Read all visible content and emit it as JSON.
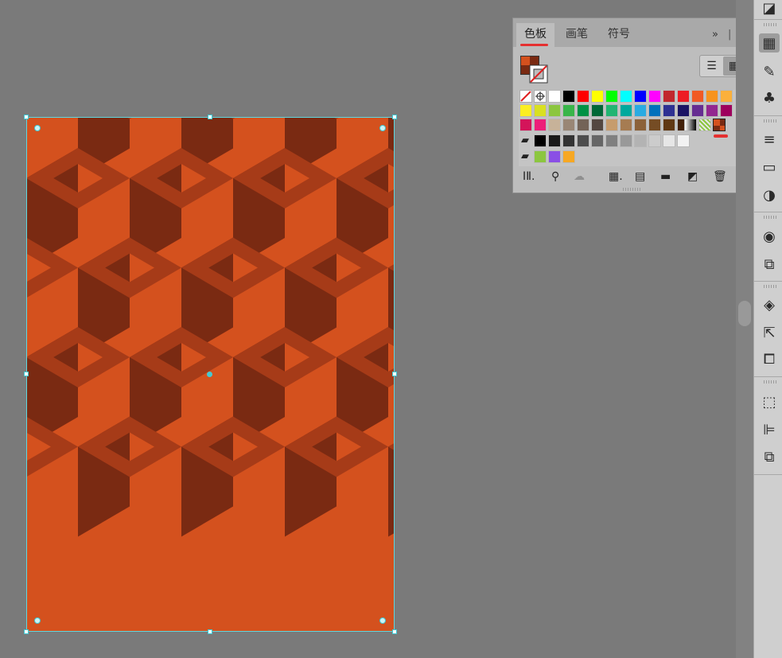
{
  "swatches_panel": {
    "tabs": [
      "色板",
      "画笔",
      "符号"
    ],
    "active_tab": "色板",
    "header_icons": [
      "expand-icon",
      "panel-menu-icon"
    ],
    "view_modes": [
      "list-view-icon",
      "grid-view-icon"
    ],
    "active_view": "grid",
    "swatch_rows": [
      [
        "#ffffff",
        "#000000",
        "#ff0000",
        "#ffff00",
        "#00ff00",
        "#00ffff",
        "#0000ff",
        "#ff00ff",
        "#c1272d",
        "#ed1c24",
        "#f15a24",
        "#f7931e",
        "#fbb03b"
      ],
      [
        "#fcee21",
        "#d9e021",
        "#8cc63f",
        "#39b54a",
        "#009245",
        "#006837",
        "#22b573",
        "#00a99d",
        "#29abe2",
        "#0071bc",
        "#2e3192",
        "#1b1464",
        "#662d91",
        "#93278f",
        "#9e005d"
      ],
      [
        "#d4145a",
        "#ed1e79",
        "#c7b299",
        "#998675",
        "#736357",
        "#534741",
        "#c69c6d",
        "#a67c52",
        "#8c6239",
        "#754c24",
        "#603813",
        "#42210b"
      ],
      [
        "#000000",
        "#1a1a1a",
        "#333333",
        "#4d4d4d",
        "#666666",
        "#808080",
        "#999999",
        "#b3b3b3",
        "#cccccc",
        "#e6e6e6",
        "#f2f2f2"
      ],
      [
        "#8cc63f",
        "#8a4fe5",
        "#f7a823"
      ]
    ],
    "footer_icons": [
      "library-icon",
      "swatch-kind-icon",
      "cloud-icon",
      "swatch-options-icon",
      "new-color-group-icon",
      "folder-icon",
      "new-swatch-icon",
      "delete-icon"
    ]
  },
  "pattern": {
    "light": "#d4511e",
    "dark": "#7a2a12",
    "mid": "#a63b18"
  },
  "tool_strip": {
    "icons": [
      "gradient-panel-icon",
      "swatches-icon",
      "brushes-icon",
      "symbols-icon",
      "stroke-icon",
      "gradient-icon",
      "transparency-icon",
      "appearance-icon",
      "graphic-styles-icon",
      "layers-icon",
      "export-icon",
      "artboards-icon",
      "transform-icon",
      "align-icon",
      "pathfinder-icon"
    ]
  }
}
